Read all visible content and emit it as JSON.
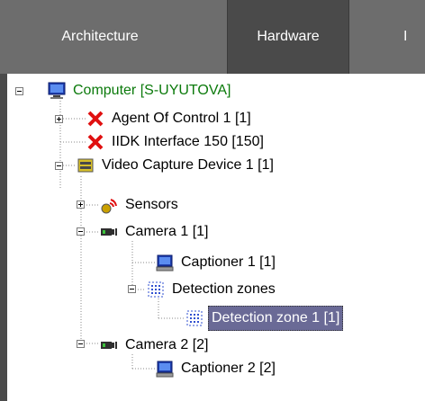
{
  "tabs": [
    {
      "label": "Architecture",
      "active": false
    },
    {
      "label": "Hardware",
      "active": true
    },
    {
      "label": "I",
      "active": false
    }
  ],
  "tree": [
    {
      "label": "Computer [S-UYUTOVA]",
      "icon": "computer-icon",
      "expander": "minus",
      "color": "#0b7a0b"
    },
    {
      "label": "Agent Of Control 1 [1]",
      "icon": "error-x-icon",
      "expander": "plus"
    },
    {
      "label": "IIDK Interface 150 [150]",
      "icon": "error-x-icon",
      "expander": null
    },
    {
      "label": "Video Capture Device 1 [1]",
      "icon": "capture-device-icon",
      "expander": "minus"
    },
    {
      "label": "Sensors",
      "icon": "sensors-icon",
      "expander": "plus"
    },
    {
      "label": "Camera 1 [1]",
      "icon": "camera-icon",
      "expander": "minus"
    },
    {
      "label": "Captioner 1 [1]",
      "icon": "captioner-icon",
      "expander": null
    },
    {
      "label": "Detection zones",
      "icon": "detection-zones-icon",
      "expander": "minus"
    },
    {
      "label": "Detection zone 1 [1]",
      "icon": "detection-zone-icon",
      "expander": null,
      "selected": true
    },
    {
      "label": "Camera 2 [2]",
      "icon": "camera-icon",
      "expander": "minus"
    },
    {
      "label": "Captioner 2 [2]",
      "icon": "captioner-icon",
      "expander": null
    }
  ]
}
